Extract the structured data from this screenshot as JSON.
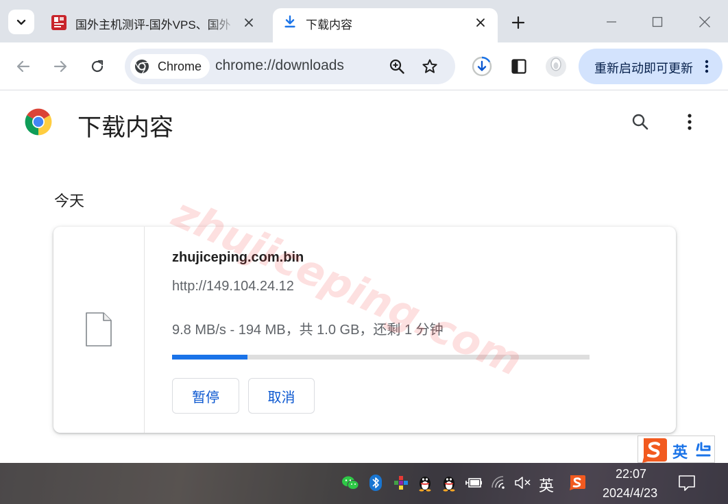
{
  "browser": {
    "tabs": [
      {
        "title": "国外主机测评-国外VPS、国外",
        "active": false
      },
      {
        "title": "下载内容",
        "active": true
      }
    ],
    "omnibox": {
      "chip_label": "Chrome",
      "url": "chrome://downloads"
    },
    "update_button_label": "重新启动即可更新"
  },
  "page": {
    "title": "下载内容",
    "section_date": "今天",
    "watermark": "zhujiceping.com",
    "downloads": [
      {
        "file_name": "zhujiceping.com.bin",
        "source_url": "http://149.104.24.12",
        "status": "9.8 MB/s - 194 MB，共 1.0 GB，还剩 1 分钟",
        "progress_fraction": 0.18,
        "pause_label": "暂停",
        "cancel_label": "取消"
      }
    ]
  },
  "ime": {
    "lang": "英"
  },
  "taskbar": {
    "ime_lang": "英",
    "time": "22:07",
    "date": "2024/4/23"
  },
  "colors": {
    "accent": "#1a73e8",
    "tabstrip_bg": "#dfe3e9",
    "omnibox_bg": "#e9edf5",
    "update_button_bg": "#d3e3fd",
    "progress_track": "#dedede",
    "watermark": "#f03c3c"
  }
}
